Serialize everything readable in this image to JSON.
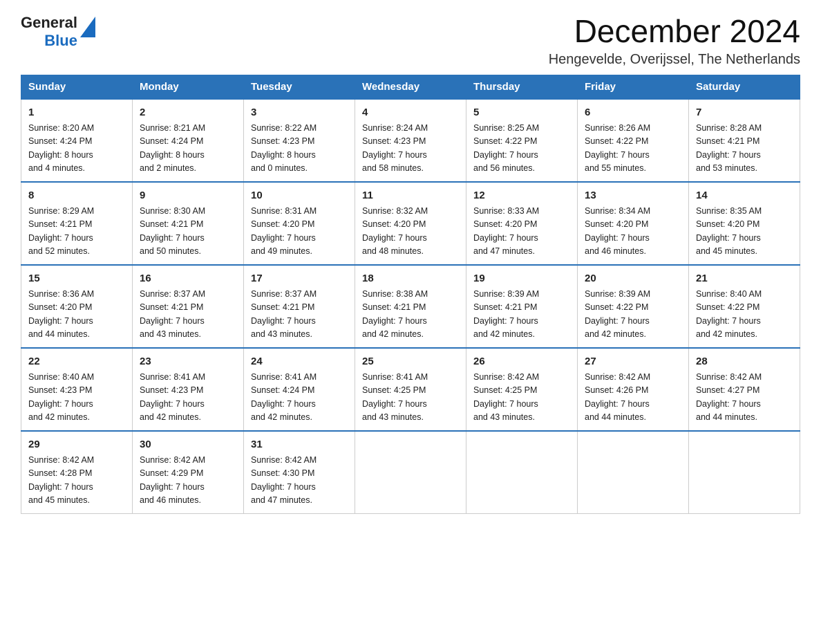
{
  "header": {
    "logo_general": "General",
    "logo_blue": "Blue",
    "month_year": "December 2024",
    "location": "Hengevelde, Overijssel, The Netherlands"
  },
  "calendar": {
    "days_of_week": [
      "Sunday",
      "Monday",
      "Tuesday",
      "Wednesday",
      "Thursday",
      "Friday",
      "Saturday"
    ],
    "weeks": [
      [
        {
          "day": "1",
          "info": "Sunrise: 8:20 AM\nSunset: 4:24 PM\nDaylight: 8 hours\nand 4 minutes."
        },
        {
          "day": "2",
          "info": "Sunrise: 8:21 AM\nSunset: 4:24 PM\nDaylight: 8 hours\nand 2 minutes."
        },
        {
          "day": "3",
          "info": "Sunrise: 8:22 AM\nSunset: 4:23 PM\nDaylight: 8 hours\nand 0 minutes."
        },
        {
          "day": "4",
          "info": "Sunrise: 8:24 AM\nSunset: 4:23 PM\nDaylight: 7 hours\nand 58 minutes."
        },
        {
          "day": "5",
          "info": "Sunrise: 8:25 AM\nSunset: 4:22 PM\nDaylight: 7 hours\nand 56 minutes."
        },
        {
          "day": "6",
          "info": "Sunrise: 8:26 AM\nSunset: 4:22 PM\nDaylight: 7 hours\nand 55 minutes."
        },
        {
          "day": "7",
          "info": "Sunrise: 8:28 AM\nSunset: 4:21 PM\nDaylight: 7 hours\nand 53 minutes."
        }
      ],
      [
        {
          "day": "8",
          "info": "Sunrise: 8:29 AM\nSunset: 4:21 PM\nDaylight: 7 hours\nand 52 minutes."
        },
        {
          "day": "9",
          "info": "Sunrise: 8:30 AM\nSunset: 4:21 PM\nDaylight: 7 hours\nand 50 minutes."
        },
        {
          "day": "10",
          "info": "Sunrise: 8:31 AM\nSunset: 4:20 PM\nDaylight: 7 hours\nand 49 minutes."
        },
        {
          "day": "11",
          "info": "Sunrise: 8:32 AM\nSunset: 4:20 PM\nDaylight: 7 hours\nand 48 minutes."
        },
        {
          "day": "12",
          "info": "Sunrise: 8:33 AM\nSunset: 4:20 PM\nDaylight: 7 hours\nand 47 minutes."
        },
        {
          "day": "13",
          "info": "Sunrise: 8:34 AM\nSunset: 4:20 PM\nDaylight: 7 hours\nand 46 minutes."
        },
        {
          "day": "14",
          "info": "Sunrise: 8:35 AM\nSunset: 4:20 PM\nDaylight: 7 hours\nand 45 minutes."
        }
      ],
      [
        {
          "day": "15",
          "info": "Sunrise: 8:36 AM\nSunset: 4:20 PM\nDaylight: 7 hours\nand 44 minutes."
        },
        {
          "day": "16",
          "info": "Sunrise: 8:37 AM\nSunset: 4:21 PM\nDaylight: 7 hours\nand 43 minutes."
        },
        {
          "day": "17",
          "info": "Sunrise: 8:37 AM\nSunset: 4:21 PM\nDaylight: 7 hours\nand 43 minutes."
        },
        {
          "day": "18",
          "info": "Sunrise: 8:38 AM\nSunset: 4:21 PM\nDaylight: 7 hours\nand 42 minutes."
        },
        {
          "day": "19",
          "info": "Sunrise: 8:39 AM\nSunset: 4:21 PM\nDaylight: 7 hours\nand 42 minutes."
        },
        {
          "day": "20",
          "info": "Sunrise: 8:39 AM\nSunset: 4:22 PM\nDaylight: 7 hours\nand 42 minutes."
        },
        {
          "day": "21",
          "info": "Sunrise: 8:40 AM\nSunset: 4:22 PM\nDaylight: 7 hours\nand 42 minutes."
        }
      ],
      [
        {
          "day": "22",
          "info": "Sunrise: 8:40 AM\nSunset: 4:23 PM\nDaylight: 7 hours\nand 42 minutes."
        },
        {
          "day": "23",
          "info": "Sunrise: 8:41 AM\nSunset: 4:23 PM\nDaylight: 7 hours\nand 42 minutes."
        },
        {
          "day": "24",
          "info": "Sunrise: 8:41 AM\nSunset: 4:24 PM\nDaylight: 7 hours\nand 42 minutes."
        },
        {
          "day": "25",
          "info": "Sunrise: 8:41 AM\nSunset: 4:25 PM\nDaylight: 7 hours\nand 43 minutes."
        },
        {
          "day": "26",
          "info": "Sunrise: 8:42 AM\nSunset: 4:25 PM\nDaylight: 7 hours\nand 43 minutes."
        },
        {
          "day": "27",
          "info": "Sunrise: 8:42 AM\nSunset: 4:26 PM\nDaylight: 7 hours\nand 44 minutes."
        },
        {
          "day": "28",
          "info": "Sunrise: 8:42 AM\nSunset: 4:27 PM\nDaylight: 7 hours\nand 44 minutes."
        }
      ],
      [
        {
          "day": "29",
          "info": "Sunrise: 8:42 AM\nSunset: 4:28 PM\nDaylight: 7 hours\nand 45 minutes."
        },
        {
          "day": "30",
          "info": "Sunrise: 8:42 AM\nSunset: 4:29 PM\nDaylight: 7 hours\nand 46 minutes."
        },
        {
          "day": "31",
          "info": "Sunrise: 8:42 AM\nSunset: 4:30 PM\nDaylight: 7 hours\nand 47 minutes."
        },
        {
          "day": "",
          "info": ""
        },
        {
          "day": "",
          "info": ""
        },
        {
          "day": "",
          "info": ""
        },
        {
          "day": "",
          "info": ""
        }
      ]
    ]
  }
}
